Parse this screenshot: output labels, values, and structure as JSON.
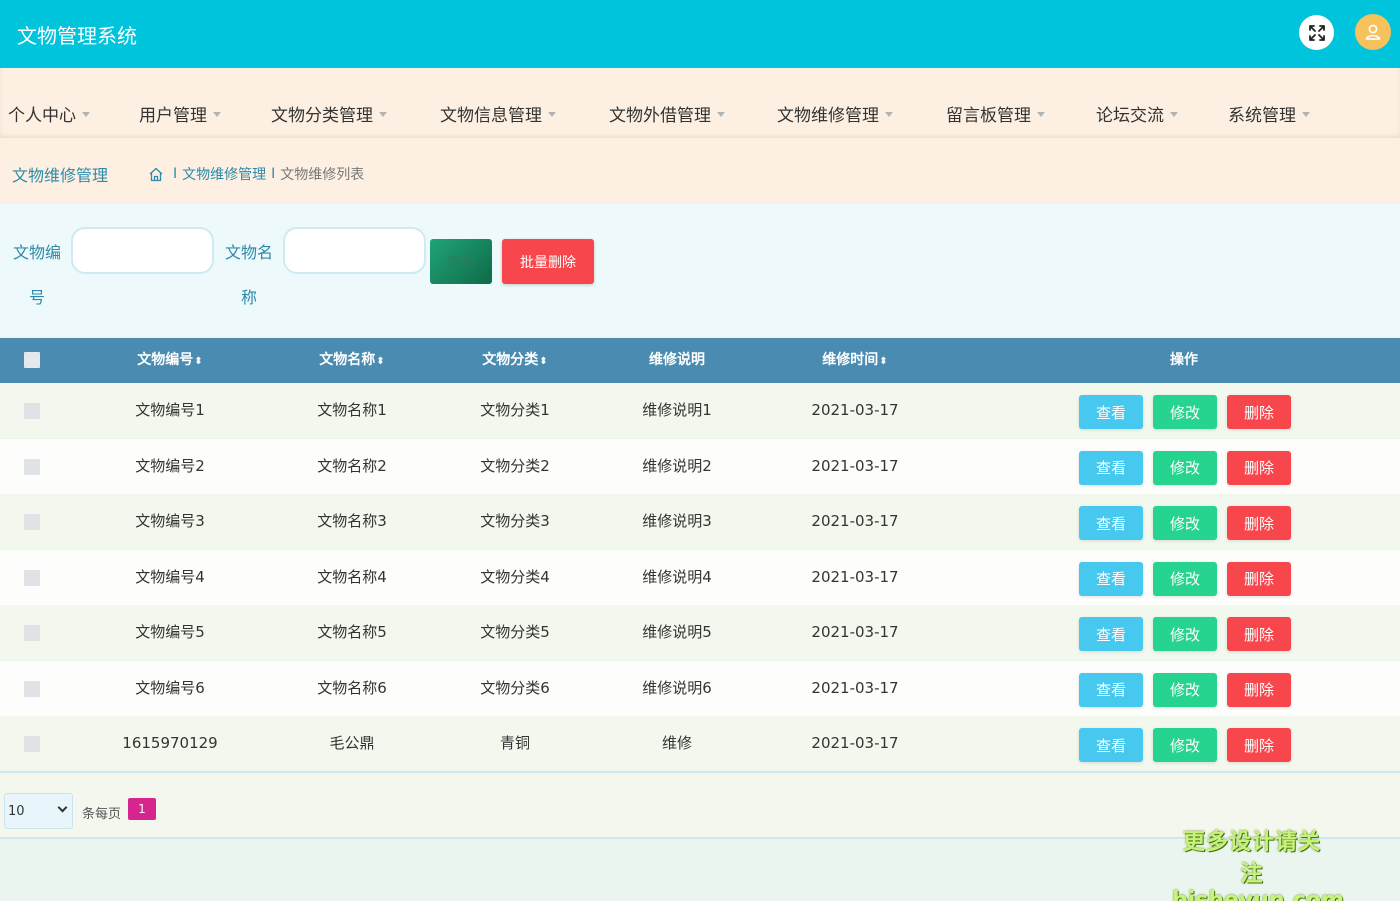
{
  "app": {
    "title": "文物管理系统"
  },
  "header": {
    "fullscreen_icon": "fullscreen-icon",
    "avatar_icon": "user-icon"
  },
  "nav": {
    "items": [
      {
        "label": "个人中心"
      },
      {
        "label": "用户管理"
      },
      {
        "label": "文物分类管理"
      },
      {
        "label": "文物信息管理"
      },
      {
        "label": "文物外借管理"
      },
      {
        "label": "文物维修管理"
      },
      {
        "label": "留言板管理"
      },
      {
        "label": "论坛交流"
      },
      {
        "label": "系统管理"
      }
    ]
  },
  "breadcrumb": {
    "page_title": "文物维修管理",
    "home_icon": "home-icon",
    "separator": "I",
    "level1": "文物维修管理",
    "level2": "文物维修列表"
  },
  "search": {
    "field1_label_line1": "文物编",
    "field1_label_line2": "号",
    "field1_value": "",
    "field2_label_line1": "文物名",
    "field2_label_line2": "称",
    "field2_value": "",
    "query_label": "查询",
    "batch_delete_label": "批量删除"
  },
  "table": {
    "columns": {
      "code": "文物编号",
      "name": "文物名称",
      "category": "文物分类",
      "desc": "维修说明",
      "time": "维修时间",
      "actions": "操作"
    },
    "sort_glyph": "⬍",
    "action_labels": {
      "view": "查看",
      "edit": "修改",
      "delete": "删除"
    },
    "rows": [
      {
        "code": "文物编号1",
        "name": "文物名称1",
        "category": "文物分类1",
        "desc": "维修说明1",
        "time": "2021-03-17"
      },
      {
        "code": "文物编号2",
        "name": "文物名称2",
        "category": "文物分类2",
        "desc": "维修说明2",
        "time": "2021-03-17"
      },
      {
        "code": "文物编号3",
        "name": "文物名称3",
        "category": "文物分类3",
        "desc": "维修说明3",
        "time": "2021-03-17"
      },
      {
        "code": "文物编号4",
        "name": "文物名称4",
        "category": "文物分类4",
        "desc": "维修说明4",
        "time": "2021-03-17"
      },
      {
        "code": "文物编号5",
        "name": "文物名称5",
        "category": "文物分类5",
        "desc": "维修说明5",
        "time": "2021-03-17"
      },
      {
        "code": "文物编号6",
        "name": "文物名称6",
        "category": "文物分类6",
        "desc": "维修说明6",
        "time": "2021-03-17"
      },
      {
        "code": "1615970129",
        "name": "毛公鼎",
        "category": "青铜",
        "desc": "维修",
        "time": "2021-03-17"
      }
    ]
  },
  "pager": {
    "page_size": "10",
    "page_size_label": "条每页",
    "current_page": "1"
  },
  "watermark": {
    "line1": "更多设计请关注",
    "line2": "bisheyun.com"
  },
  "colors": {
    "topbar": "#00c3dc",
    "table_header": "#4a8bb1",
    "view": "#47c8ee",
    "edit": "#27d48f",
    "delete": "#f7464c",
    "page_active": "#d6258c"
  }
}
